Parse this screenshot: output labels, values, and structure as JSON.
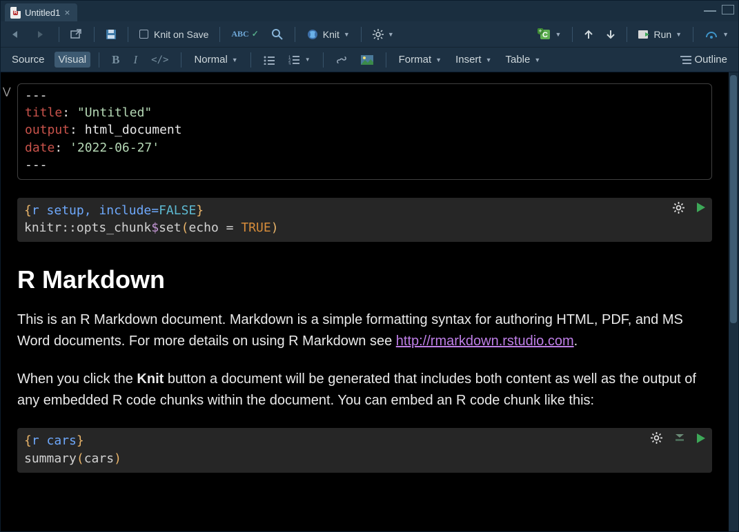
{
  "tab": {
    "title": "Untitled1"
  },
  "toolbar1": {
    "knit_on_save": "Knit on Save",
    "knit_label": "Knit",
    "run_label": "Run"
  },
  "toolbar2": {
    "source": "Source",
    "visual": "Visual",
    "paragraph_style": "Normal",
    "format": "Format",
    "insert": "Insert",
    "table": "Table",
    "outline": "Outline"
  },
  "yaml": {
    "delim": "---",
    "title_key": "title",
    "title_val": "\"Untitled\"",
    "output_key": "output",
    "output_val": "html_document",
    "date_key": "date",
    "date_val": "'2022-06-27'"
  },
  "chunk1": {
    "header_open": "{",
    "lang": "r",
    "name": " setup",
    "opts": ", include=",
    "false": "FALSE",
    "header_close": "}",
    "line2_a": "knitr",
    "line2_b": "::",
    "line2_c": "opts_chunk",
    "line2_d": "$",
    "line2_e": "set",
    "line2_f": "(",
    "line2_g": "echo",
    "line2_h": " = ",
    "line2_true": "TRUE",
    "line2_close": ")"
  },
  "heading": "R Markdown",
  "para1_a": "This is an R Markdown document. Markdown is a simple formatting syntax for authoring HTML, PDF, and MS Word documents. For more details on using R Markdown see ",
  "para1_link": "http://rmarkdown.rstudio.com",
  "para1_b": ".",
  "para2_a": "When you click the ",
  "para2_bold": "Knit",
  "para2_b": " button a document will be generated that includes both content as well as the output of any embedded R code chunks within the document. You can embed an R code chunk like this:",
  "chunk2": {
    "header_open": "{",
    "lang": "r",
    "name": " cars",
    "header_close": "}",
    "line2_a": "summary",
    "line2_b": "(",
    "line2_c": "cars",
    "line2_d": ")"
  }
}
